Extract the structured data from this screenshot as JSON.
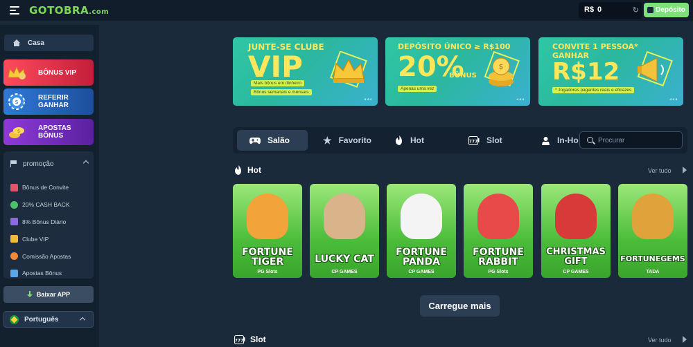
{
  "header": {
    "logo_text": "GOTOBRA",
    "logo_suffix": ".com",
    "currency": "R$",
    "balance": "0",
    "deposit_label": "Depósito"
  },
  "sidebar": {
    "home_label": "Casa",
    "promos": [
      {
        "label_line1": "BÔNUS VIP",
        "label_line2": ""
      },
      {
        "label_line1": "REFERIR",
        "label_line2": "GANHAR"
      },
      {
        "label_line1": "APOSTAS",
        "label_line2": "BÔNUS"
      }
    ],
    "promotion_header": "promoção",
    "promotion_items": [
      {
        "label": "Bônus de Convite",
        "color": "#e0556a"
      },
      {
        "label": "20% CASH BACK",
        "color": "#4cc26a"
      },
      {
        "label": "8% Bônus Diário",
        "color": "#8a6be0"
      },
      {
        "label": "Clube VIP",
        "color": "#f1b93a"
      },
      {
        "label": "Comissão Apostas",
        "color": "#f08a3a"
      },
      {
        "label": "Apostas Bônus",
        "color": "#5aa6e8"
      }
    ],
    "app_button_label": "Baixar APP",
    "language_label": "Português"
  },
  "banners": [
    {
      "title": "JUNTE-SE CLUBE",
      "big": "VIP",
      "tag1": "Mais bônus em dinheiro",
      "tag2": "Bônus semanais e mensais"
    },
    {
      "title": "DEPÓSITO ÚNICO ≥ R$100",
      "big": "20%",
      "big_suffix": "BÔNUS",
      "tag1": "Apenas uma vez"
    },
    {
      "title": "CONVITE 1 PESSOA*",
      "subtitle": "GANHAR",
      "big": "R$12",
      "tag1": "* Jogadores pagantes reais e eficazes"
    }
  ],
  "tabs": [
    {
      "label": "Salão",
      "icon": "gamepad-icon"
    },
    {
      "label": "Favorito",
      "icon": "star-icon"
    },
    {
      "label": "Hot",
      "icon": "flame-icon"
    },
    {
      "label": "Slot",
      "icon": "slot-777-icon"
    },
    {
      "label": "In-Ho",
      "icon": "in-house-icon"
    }
  ],
  "search": {
    "placeholder": "Procurar"
  },
  "sections": {
    "hot_title": "Hot",
    "slot_title": "Slot",
    "see_all": "Ver tudo"
  },
  "games": [
    {
      "line1": "FORTUNE",
      "line2": "TIGER",
      "provider": "PG Slots",
      "art_color": "#f2a33a"
    },
    {
      "line1": "LUCKY CAT",
      "line2": "",
      "provider": "CP GAMES",
      "art_color": "#d9b38a"
    },
    {
      "line1": "FORTUNE",
      "line2": "PANDA",
      "provider": "CP GAMES",
      "art_color": "#f4f4f4"
    },
    {
      "line1": "FORTUNE",
      "line2": "RABBIT",
      "provider": "PG Slots",
      "art_color": "#e84a4a"
    },
    {
      "line1": "CHRISTMAS",
      "line2": "GIFT",
      "provider": "CP GAMES",
      "art_color": "#d83a3a"
    },
    {
      "line1": "FORTUNEGEMS",
      "line2": "",
      "provider": "TADA",
      "art_color": "#e0a23a"
    }
  ],
  "load_more_label": "Carregue mais"
}
